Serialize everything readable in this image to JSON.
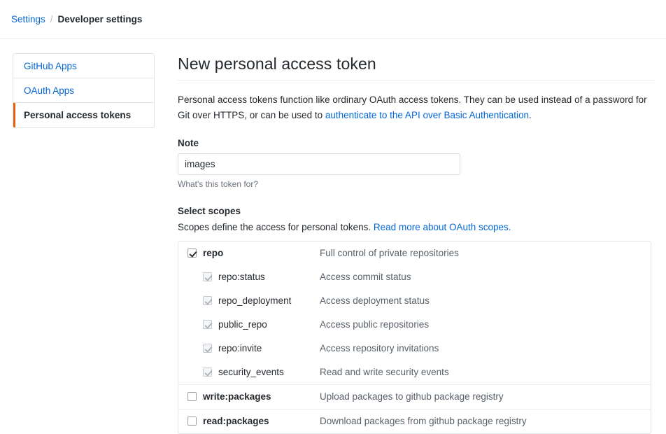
{
  "breadcrumb": {
    "root_label": "Settings",
    "separator": "/",
    "current_label": "Developer settings"
  },
  "sidebar": {
    "items": [
      {
        "label": "GitHub Apps",
        "selected": false
      },
      {
        "label": "OAuth Apps",
        "selected": false
      },
      {
        "label": "Personal access tokens",
        "selected": true
      }
    ]
  },
  "main": {
    "title": "New personal access token",
    "intro_text_before": "Personal access tokens function like ordinary OAuth access tokens. They can be used instead of a password for Git over HTTPS, or can be used to ",
    "intro_link": "authenticate to the API over Basic Authentication",
    "intro_text_after": ".",
    "note": {
      "label": "Note",
      "value": "images",
      "placeholder": "What's this token for?",
      "help": "What's this token for?"
    },
    "scopes_section": {
      "title": "Select scopes",
      "desc_text": "Scopes define the access for personal tokens. ",
      "desc_link": "Read more about OAuth scopes."
    }
  },
  "scopes": [
    {
      "name": "repo",
      "description": "Full control of private repositories",
      "checked": true,
      "disabled": false,
      "children": [
        {
          "name": "repo:status",
          "description": "Access commit status",
          "checked": true,
          "disabled": true
        },
        {
          "name": "repo_deployment",
          "description": "Access deployment status",
          "checked": true,
          "disabled": true
        },
        {
          "name": "public_repo",
          "description": "Access public repositories",
          "checked": true,
          "disabled": true
        },
        {
          "name": "repo:invite",
          "description": "Access repository invitations",
          "checked": true,
          "disabled": true
        },
        {
          "name": "security_events",
          "description": "Read and write security events",
          "checked": true,
          "disabled": true
        }
      ]
    },
    {
      "name": "write:packages",
      "description": "Upload packages to github package registry",
      "checked": false,
      "disabled": false,
      "children": []
    },
    {
      "name": "read:packages",
      "description": "Download packages from github package registry",
      "checked": false,
      "disabled": false,
      "children": []
    }
  ],
  "colors": {
    "link": "#0366d6",
    "accent_selected": "#e36209",
    "text": "#24292e",
    "muted": "#586069",
    "border": "#e1e4e8"
  }
}
